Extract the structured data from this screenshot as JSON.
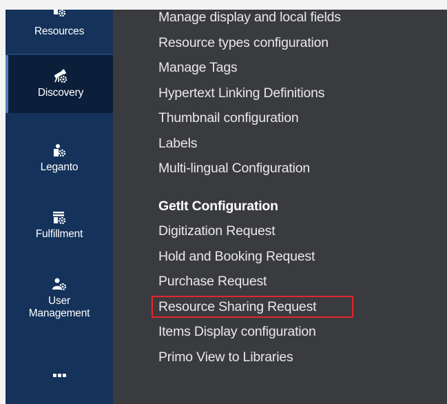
{
  "sidebar": {
    "items": [
      {
        "key": "resources",
        "label": "Resources",
        "icon": "resources-icon",
        "active": false
      },
      {
        "key": "discovery",
        "label": "Discovery",
        "icon": "discovery-telescope-icon",
        "active": true
      },
      {
        "key": "leganto",
        "label": "Leganto",
        "icon": "leganto-icon",
        "active": false
      },
      {
        "key": "fulfillment",
        "label": "Fulfillment",
        "icon": "fulfillment-icon",
        "active": false
      },
      {
        "key": "user-management",
        "label": "User Management",
        "label_lines": [
          "User",
          "Management"
        ],
        "icon": "user-management-icon",
        "active": false
      }
    ],
    "more_icon": "more-dots-icon"
  },
  "menu": {
    "display_links": [
      "Manage display and local fields",
      "Resource types configuration",
      "Manage Tags",
      "Hypertext Linking Definitions",
      "Thumbnail configuration",
      "Labels",
      "Multi-lingual Configuration"
    ],
    "getit_heading": "GetIt Configuration",
    "getit_links": [
      "Digitization Request",
      "Hold and Booking Request",
      "Purchase Request",
      "Resource Sharing Request",
      "Items Display configuration",
      "Primo View to Libraries"
    ],
    "highlighted_item": "Resource Sharing Request"
  },
  "colors": {
    "sidebar_bg": "#14325a",
    "sidebar_active_bg": "#0b1f3b",
    "active_indicator": "#4e7ec1",
    "main_bg": "#3a3b3f",
    "link_text": "#e9e9e9",
    "highlight_border": "#e3262c"
  }
}
